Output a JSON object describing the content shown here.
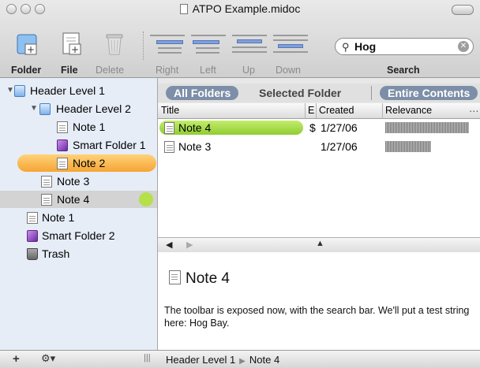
{
  "window": {
    "title": "ATPO Example.midoc"
  },
  "toolbar": {
    "folder": "Folder",
    "file": "File",
    "delete": "Delete",
    "right": "Right",
    "left": "Left",
    "up": "Up",
    "down": "Down",
    "search_label": "Search",
    "search_value": "Hog"
  },
  "sidebar": {
    "items": [
      {
        "label": "Header Level 1",
        "icon": "folder-icon"
      },
      {
        "label": "Header Level 2",
        "icon": "folder-icon"
      },
      {
        "label": "Note 1",
        "icon": "note-icon"
      },
      {
        "label": "Smart Folder 1",
        "icon": "smart-folder-icon"
      },
      {
        "label": "Note 2",
        "icon": "note-icon"
      },
      {
        "label": "Note 3",
        "icon": "note-icon"
      },
      {
        "label": "Note 4",
        "icon": "note-icon"
      },
      {
        "label": "Note 1",
        "icon": "note-icon"
      },
      {
        "label": "Smart Folder 2",
        "icon": "smart-folder-icon"
      },
      {
        "label": "Trash",
        "icon": "trash-icon"
      }
    ]
  },
  "scope": {
    "all": "All Folders",
    "selected": "Selected Folder",
    "entire": "Entire Contents"
  },
  "table": {
    "headers": {
      "title": "Title",
      "e": "E",
      "created": "Created",
      "relevance": "Relevance"
    },
    "rows": [
      {
        "title": "Note 4",
        "e": "$",
        "created": "1/27/06",
        "relevance": 1.0
      },
      {
        "title": "Note 3",
        "e": "",
        "created": "1/27/06",
        "relevance": 0.55
      }
    ]
  },
  "note": {
    "title": "Note 4",
    "body": "The toolbar is exposed now, with the search bar. We'll put a test string here: Hog Bay."
  },
  "breadcrumb": {
    "a": "Header Level 1",
    "b": "Note 4"
  },
  "colors": {
    "selection_orange": "#f6a534",
    "selection_green": "#8fcd30",
    "scope_active": "#7d8fa8"
  }
}
